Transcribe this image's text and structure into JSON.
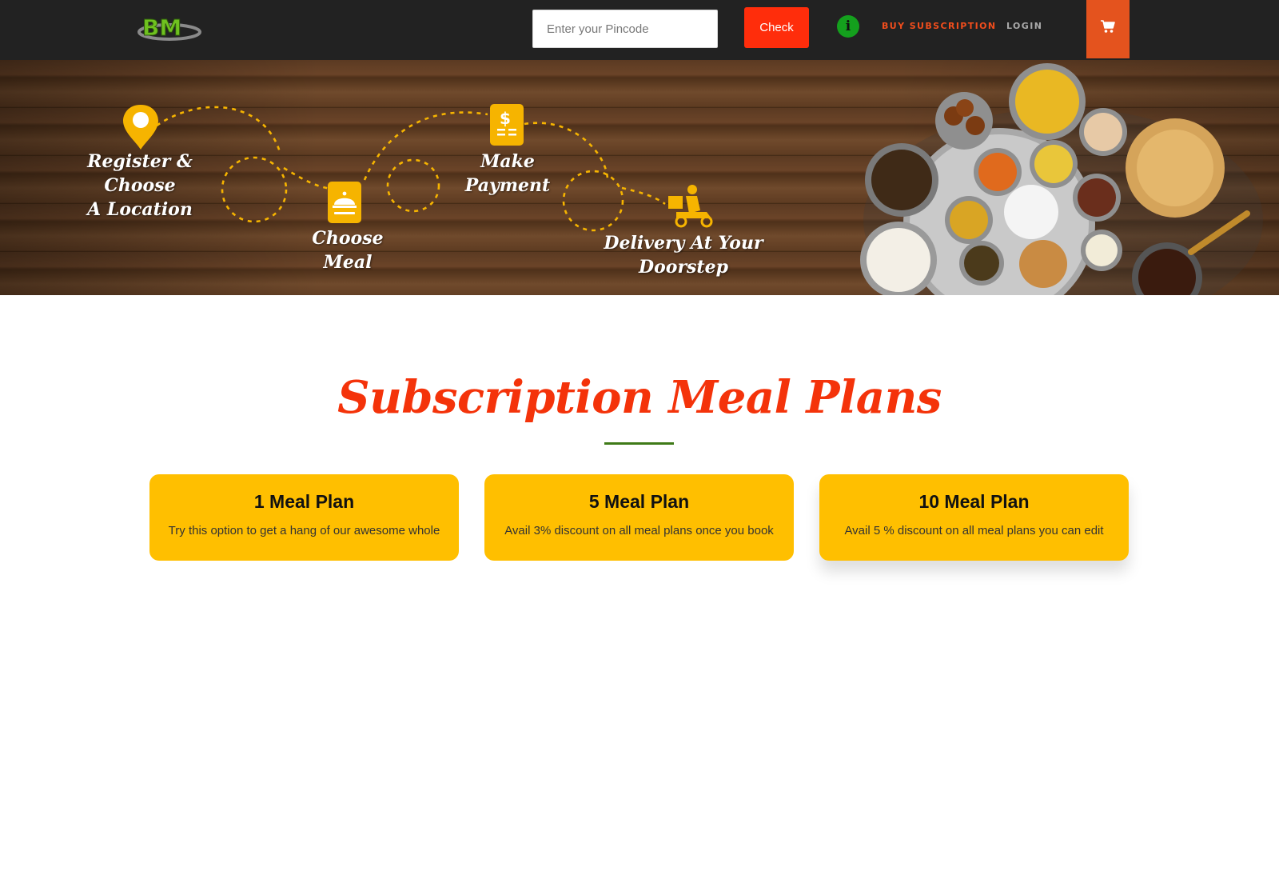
{
  "header": {
    "logo_text": "BM",
    "pincode_placeholder": "Enter your Pincode",
    "check_label": "Check",
    "info_icon": "i",
    "buy_subscription_label": "BUY SUBSCRIPTION",
    "login_label": "LOGIN",
    "cart_icon": "cart-icon"
  },
  "hero": {
    "steps": [
      {
        "label_line1": "Register & Choose",
        "label_line2": "A Location",
        "icon": "location-pin-icon"
      },
      {
        "label_line1": "Choose Meal",
        "icon": "food-cloche-icon"
      },
      {
        "label_line1": "Make Payment",
        "icon": "receipt-dollar-icon"
      },
      {
        "label_line1": "Delivery At Your Doorstep",
        "icon": "delivery-scooter-icon"
      }
    ]
  },
  "section": {
    "title": "Subscription Meal Plans"
  },
  "plans": [
    {
      "title": "1 Meal Plan",
      "description": "Try this option to get a hang of our awesome whole"
    },
    {
      "title": "5 Meal Plan",
      "description": "Avail 3% discount on all meal plans once you book"
    },
    {
      "title": "10 Meal Plan",
      "description": "Avail 5 % discount on all meal plans you can edit"
    }
  ],
  "colors": {
    "navbar": "#222222",
    "check_button": "#ff2d0b",
    "accent_orange": "#e4531e",
    "title_red": "#f4330a",
    "card_yellow": "#ffbf00",
    "underline_green": "#3f7a18",
    "info_green": "#14a01d"
  }
}
